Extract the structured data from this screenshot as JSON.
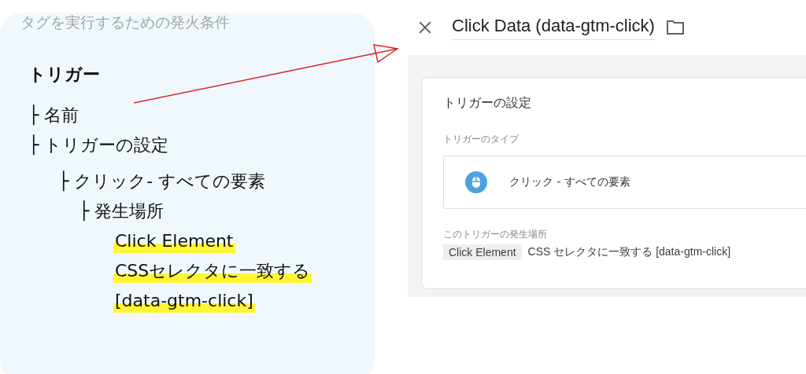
{
  "note": {
    "caption": "タグを実行するための発火条件",
    "title": "トリガー",
    "tree": [
      {
        "label": "├ 名前"
      },
      {
        "label": "├ トリガーの設定",
        "children": [
          {
            "label": "├ クリック- すべての要素",
            "children": [
              {
                "label": "├ 発生場所",
                "highlights": [
                  "Click Element",
                  "CSSセレクタに一致する",
                  "[data-gtm-click]"
                ]
              }
            ]
          }
        ]
      }
    ]
  },
  "editor": {
    "title": "Click Data (data-gtm-click)",
    "card": {
      "heading": "トリガーの設定",
      "type_label": "トリガーのタイプ",
      "type_value": "クリック - すべての要素",
      "where_label": "このトリガーの発生場所",
      "condition": {
        "variable": "Click Element",
        "rule": "CSS セレクタに一致する [data-gtm-click]"
      }
    }
  }
}
